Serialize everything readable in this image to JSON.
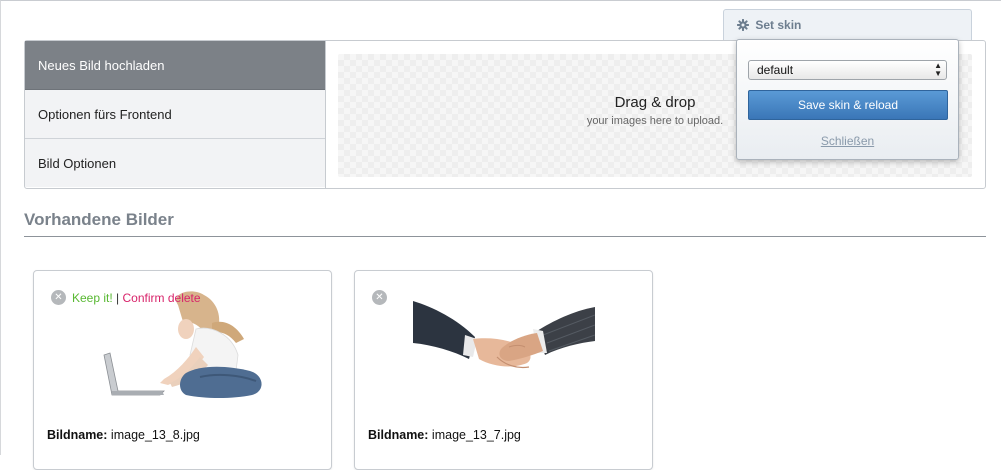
{
  "upload": {
    "tabs": [
      {
        "label": "Neues Bild hochladen",
        "active": true
      },
      {
        "label": "Optionen fürs Frontend",
        "active": false
      },
      {
        "label": "Bild Optionen",
        "active": false
      }
    ],
    "dropzone": {
      "title": "Drag & drop",
      "subtitle": "your images here to upload."
    }
  },
  "skin": {
    "tab_label": "Set skin",
    "tab_icon": "gear-icon",
    "selected": "default",
    "save_label": "Save skin & reload",
    "close_label": "Schließen",
    "accent": "#3f7cbf"
  },
  "gallery": {
    "heading": "Vorhandene Bilder",
    "caption_label": "Bildname:",
    "keep_label": "Keep it!",
    "separator": "|",
    "confirm_label": "Confirm delete",
    "keep_color": "#58b832",
    "confirm_color": "#d8236a",
    "images": [
      {
        "filename": "image_13_8.jpg",
        "depicts": "woman-with-laptop",
        "delete_pending": true
      },
      {
        "filename": "image_13_7.jpg",
        "depicts": "handshake",
        "delete_pending": false
      }
    ]
  }
}
